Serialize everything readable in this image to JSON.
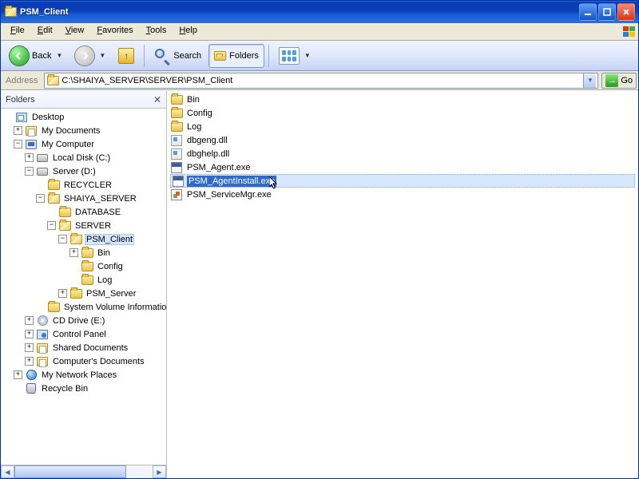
{
  "window": {
    "title": "PSM_Client"
  },
  "menu": {
    "items": [
      "File",
      "Edit",
      "View",
      "Favorites",
      "Tools",
      "Help"
    ]
  },
  "toolbar": {
    "back": "Back",
    "search": "Search",
    "folders": "Folders"
  },
  "address": {
    "label": "Address",
    "path": "C:\\SHAIYA_SERVER\\SERVER\\PSM_Client",
    "go": "Go"
  },
  "side": {
    "header": "Folders",
    "tree": {
      "desktop": "Desktop",
      "mydocs": "My Documents",
      "mycomp": "My Computer",
      "localc": "Local Disk (C:)",
      "serverd": "Server (D:)",
      "recycler": "RECYCLER",
      "shaiya": "SHAIYA_SERVER",
      "database": "DATABASE",
      "server": "SERVER",
      "psmclient": "PSM_Client",
      "bin": "Bin",
      "config": "Config",
      "log": "Log",
      "psmserver": "PSM_Server",
      "sysvol": "System Volume Information",
      "cddrive": "CD Drive (E:)",
      "ctrlpanel": "Control Panel",
      "shareddocs": "Shared Documents",
      "compdocs": "Computer's Documents",
      "netplaces": "My Network Places",
      "recyclebin": "Recycle Bin"
    }
  },
  "files": {
    "items": [
      {
        "name": "Bin",
        "type": "folder"
      },
      {
        "name": "Config",
        "type": "folder"
      },
      {
        "name": "Log",
        "type": "folder"
      },
      {
        "name": "dbgeng.dll",
        "type": "dll"
      },
      {
        "name": "dbghelp.dll",
        "type": "dll"
      },
      {
        "name": "PSM_Agent.exe",
        "type": "exe"
      },
      {
        "name": "PSM_AgentInstall.exe",
        "type": "exe",
        "selected": true
      },
      {
        "name": "PSM_ServiceMgr.exe",
        "type": "exe2"
      }
    ]
  }
}
